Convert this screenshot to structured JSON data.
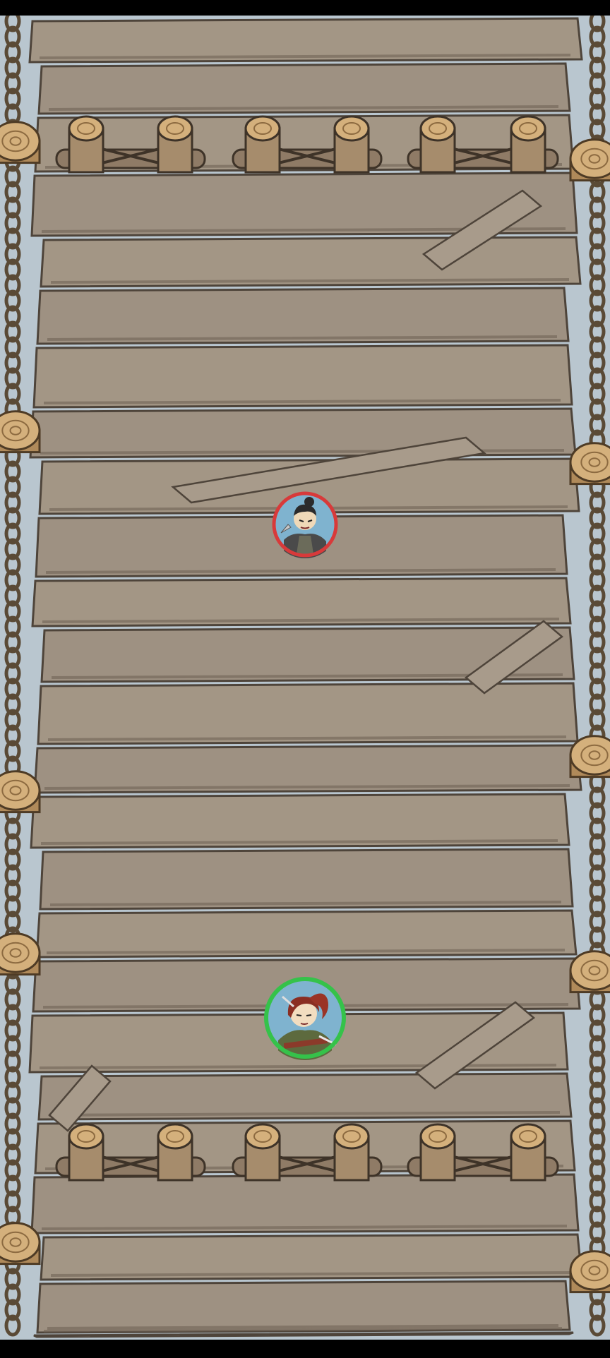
{
  "game": {
    "screen": "rope-bridge-battlefield",
    "opponent": {
      "name": "enemy-ninja-token",
      "ring_color": "#d83a3a",
      "role": "enemy"
    },
    "player": {
      "name": "player-swordswoman-token",
      "ring_color": "#35c24a",
      "role": "player"
    }
  },
  "colors": {
    "plank": "#9e9182",
    "plank_dark": "#6c5f52",
    "plank_line": "#4e443a",
    "water": "#b9c6cf",
    "chain": "#5a4a36",
    "post_top": "#d4b07c",
    "enemy_ring": "#d83a3a",
    "player_ring": "#35c24a"
  }
}
